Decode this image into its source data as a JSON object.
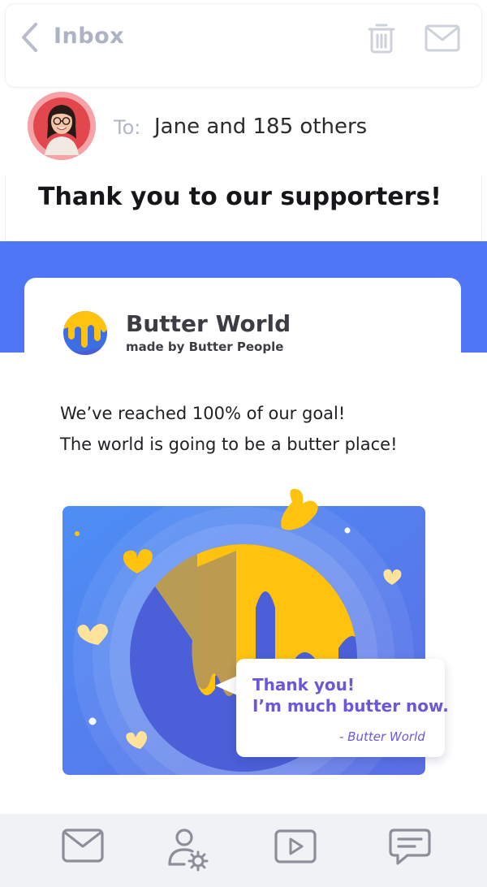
{
  "header": {
    "back_icon": "chevron-left-icon",
    "title": "Inbox",
    "actions": [
      {
        "name": "delete",
        "icon": "trash-icon"
      },
      {
        "name": "mail",
        "icon": "envelope-icon"
      }
    ]
  },
  "message": {
    "to_label": "To:",
    "recipients": "Jane and 185 others",
    "subject": "Thank you to our supporters!",
    "sender_avatar": "avatar"
  },
  "email_body": {
    "brand_name": "Butter World",
    "brand_tagline": "made by Butter People",
    "lines": [
      "We’ve reached 100% of our goal!",
      "The world is going to be a butter place!"
    ],
    "bubble": {
      "line1": "Thank you!",
      "line2": "I’m much butter now.",
      "signature": "- Butter World"
    }
  },
  "bottom_nav": {
    "items": [
      {
        "name": "mail",
        "icon": "envelope-icon"
      },
      {
        "name": "profile-settings",
        "icon": "user-settings-icon"
      },
      {
        "name": "video",
        "icon": "play-icon"
      },
      {
        "name": "messages",
        "icon": "chat-icon"
      }
    ]
  },
  "colors": {
    "accent_blue": "#4f77f5",
    "butter_yellow": "#ffc20e",
    "bubble_text": "#6b58d8",
    "muted_icon": "#aeb3c4",
    "avatar_ring": "#f59ea3"
  }
}
